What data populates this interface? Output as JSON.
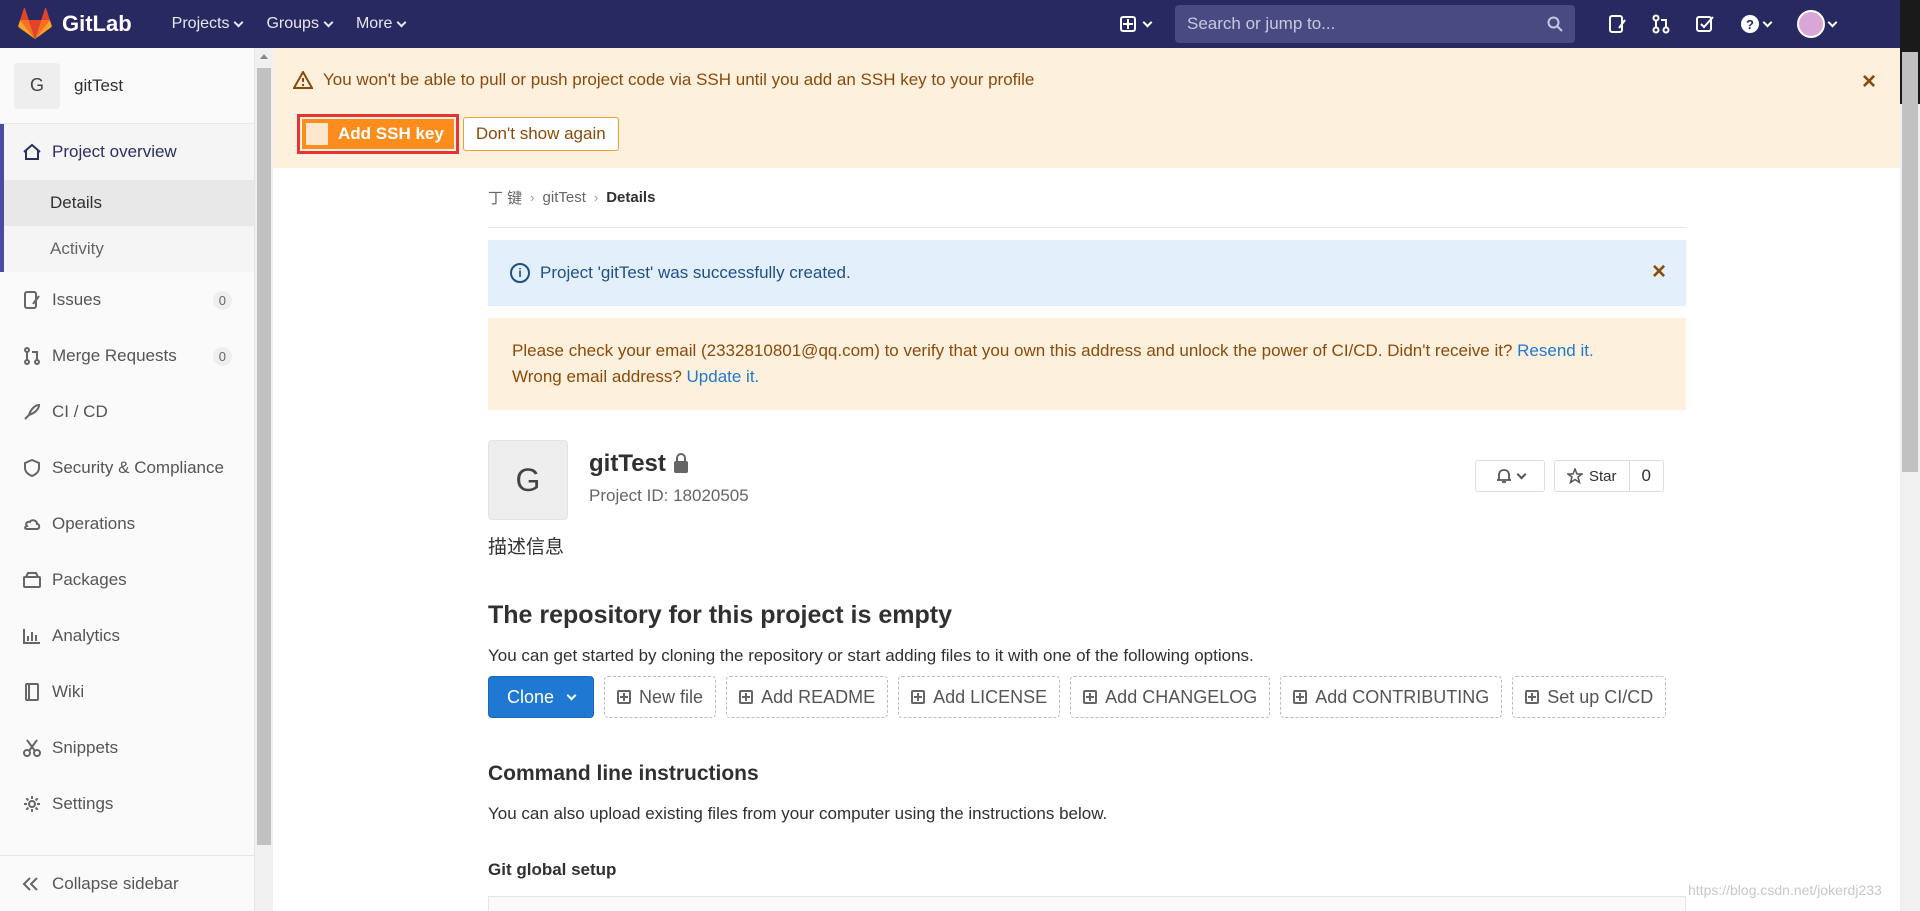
{
  "navbar": {
    "brand": "GitLab",
    "menu": [
      {
        "label": "Projects"
      },
      {
        "label": "Groups"
      },
      {
        "label": "More"
      }
    ],
    "search_placeholder": "Search or jump to..."
  },
  "sidebar": {
    "project_initial": "G",
    "project_name": "gitTest",
    "active": {
      "label": "Project overview",
      "subitems": [
        "Details",
        "Activity"
      ]
    },
    "items": [
      {
        "label": "Issues",
        "icon": "issues-icon",
        "badge": "0"
      },
      {
        "label": "Merge Requests",
        "icon": "merge-request-icon",
        "badge": "0"
      },
      {
        "label": "CI / CD",
        "icon": "rocket-icon"
      },
      {
        "label": "Security & Compliance",
        "icon": "shield-icon"
      },
      {
        "label": "Operations",
        "icon": "cloud-icon"
      },
      {
        "label": "Packages",
        "icon": "package-icon"
      },
      {
        "label": "Analytics",
        "icon": "chart-icon"
      },
      {
        "label": "Wiki",
        "icon": "book-icon"
      },
      {
        "label": "Snippets",
        "icon": "scissors-icon"
      },
      {
        "label": "Settings",
        "icon": "gear-icon"
      }
    ],
    "collapse_label": "Collapse sidebar"
  },
  "ssh_alert": {
    "message": "You won't be able to pull or push project code via SSH until you add an SSH key to your profile",
    "add_button": "Add SSH key",
    "dismiss_button": "Don't show again"
  },
  "breadcrumb": {
    "items": [
      "丁 键",
      "gitTest",
      "Details"
    ]
  },
  "info_alert": {
    "message": "Project 'gitTest' was successfully created."
  },
  "email_alert": {
    "text1": "Please check your email (2332810801@qq.com) to verify that you own this address and unlock the power of CI/CD. Didn't receive it?",
    "link1": "Resend it.",
    "text2": "Wrong email address?",
    "link2": "Update it."
  },
  "project": {
    "initial": "G",
    "name": "gitTest",
    "id_text": "Project ID: 18020505",
    "star_label": "Star",
    "star_count": "0",
    "description": "描述信息"
  },
  "empty_repo": {
    "heading": "The repository for this project is empty",
    "subtext": "You can get started by cloning the repository or start adding files to it with one of the following options.",
    "clone_label": "Clone",
    "buttons": [
      "New file",
      "Add README",
      "Add LICENSE",
      "Add CHANGELOG",
      "Add CONTRIBUTING",
      "Set up CI/CD"
    ]
  },
  "cli": {
    "heading": "Command line instructions",
    "subtext": "You can also upload existing files from your computer using the instructions below.",
    "git_setup": "Git global setup"
  },
  "watermark": "https://blog.csdn.net/jokerdj233"
}
